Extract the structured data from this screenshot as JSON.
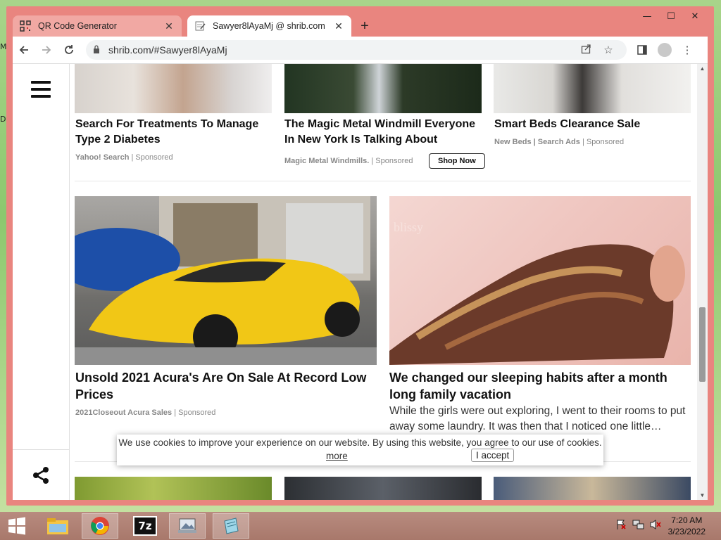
{
  "window": {
    "minimize_glyph": "—",
    "maximize_glyph": "☐",
    "close_glyph": "✕"
  },
  "tabs": [
    {
      "title": "QR Code Generator",
      "icon": "qr-icon",
      "active": false
    },
    {
      "title": "Sawyer8lAyaMj @ shrib.com",
      "icon": "note-icon",
      "active": true
    }
  ],
  "toolbar": {
    "url": "shrib.com/#Sawyer8lAyaMj"
  },
  "ads_top": [
    {
      "title": "Search For Treatments To Manage Type 2 Diabetes",
      "source": "Yahoo! Search",
      "sponsored": "Sponsored"
    },
    {
      "title": "The Magic Metal Windmill Everyone In New York Is Talking About",
      "source": "Magic Metal Windmills.",
      "sponsored": "Sponsored",
      "cta": "Shop Now"
    },
    {
      "title": "Smart Beds Clearance Sale",
      "source": "New Beds | Search Ads",
      "sponsored": "Sponsored"
    }
  ],
  "ads_big": [
    {
      "title": "Unsold 2021 Acura's Are On Sale At Record Low Prices",
      "source": "2021Closeout Acura Sales",
      "sponsored": "Sponsored"
    },
    {
      "title": "We changed our sleeping habits after a month long family vacation",
      "description": "While the girls were out exploring, I went to their rooms to put away some laundry. It was then that I noticed one little…",
      "brand_watermark": "blissy"
    }
  ],
  "cookie": {
    "message": "We use cookies to improve your experience on our website. By using this website, you agree to our use of cookies.",
    "more": "more",
    "accept": "I accept"
  },
  "taskbar": {
    "time": "7:20 AM",
    "date": "3/23/2022",
    "sevenzip_label": "7z"
  },
  "desktop": {
    "edge_label_1": "M",
    "edge_label_2": "D"
  }
}
